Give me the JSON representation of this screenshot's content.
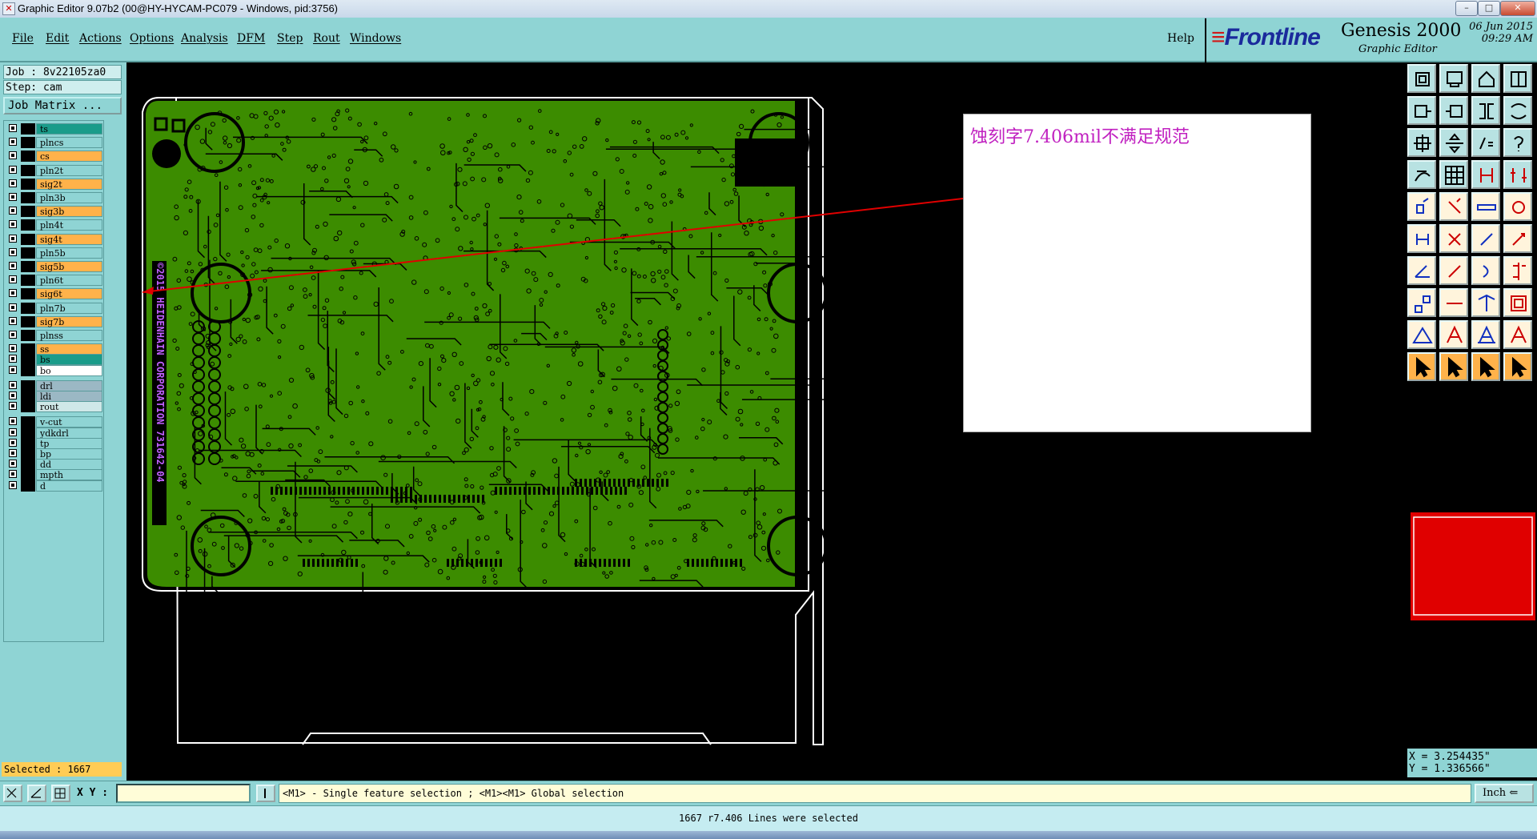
{
  "window": {
    "title": "Graphic Editor 9.07b2 (00@HY-HYCAM-PC079 - Windows, pid:3756)",
    "minimize": "–",
    "maximize": "□",
    "close": "✕"
  },
  "menu": [
    "File",
    "Edit",
    "Actions",
    "Options",
    "Analysis",
    "DFM",
    "Step",
    "Rout",
    "Windows"
  ],
  "help_label": "Help",
  "brand": {
    "logo": "Frontline",
    "product": "Genesis 2000",
    "subtitle": "Graphic Editor",
    "date": "06 Jun 2015",
    "time": "09:29 AM"
  },
  "job": {
    "job_line": "Job : 8v22105za0",
    "step_line": "Step: cam",
    "matrix_button": "Job Matrix ..."
  },
  "layers": [
    {
      "name": "ts",
      "color": "#1a9c8a"
    },
    {
      "name": "plncs",
      "color": "#8fd4d4"
    },
    {
      "name": "cs",
      "color": "#ffb24a"
    },
    {
      "name": "pln2t",
      "color": "#8fd4d4"
    },
    {
      "name": "sig2t",
      "color": "#ffb24a"
    },
    {
      "name": "pln3b",
      "color": "#8fd4d4"
    },
    {
      "name": "sig3b",
      "color": "#ffb24a"
    },
    {
      "name": "pln4t",
      "color": "#8fd4d4"
    },
    {
      "name": "sig4t",
      "color": "#ffb24a"
    },
    {
      "name": "pln5b",
      "color": "#8fd4d4"
    },
    {
      "name": "sig5b",
      "color": "#ffb24a"
    },
    {
      "name": "pln6t",
      "color": "#8fd4d4"
    },
    {
      "name": "sig6t",
      "color": "#ffb24a"
    },
    {
      "name": "pln7b",
      "color": "#8fd4d4"
    },
    {
      "name": "sig7b",
      "color": "#ffb24a"
    },
    {
      "name": "plnss",
      "color": "#8fd4d4"
    },
    {
      "name": "ss",
      "color": "#ffb24a"
    },
    {
      "name": "bs",
      "color": "#1a9c8a"
    },
    {
      "name": "bo",
      "color": "#ffffff"
    },
    {
      "name": "drl",
      "color": "#9bb8c4"
    },
    {
      "name": "ldi",
      "color": "#9bb8c4"
    },
    {
      "name": "rout",
      "color": "#cfe8e8"
    },
    {
      "name": "v-cut",
      "color": "#8fd4d4"
    },
    {
      "name": "ydkdrl",
      "color": "#8fd4d4"
    },
    {
      "name": "tp",
      "color": "#8fd4d4"
    },
    {
      "name": "bp",
      "color": "#8fd4d4"
    },
    {
      "name": "dd",
      "color": "#8fd4d4"
    },
    {
      "name": "mpth",
      "color": "#8fd4d4"
    },
    {
      "name": "d",
      "color": "#8fd4d4"
    }
  ],
  "selected_count": "Selected : 1667",
  "board": {
    "silkscreen_text": "©2015 HEIDENHAIN CORPORATION 731642-04",
    "copper_color": "#3c8c00",
    "silk_color": "#c060ff"
  },
  "annotation": {
    "text": "蚀刻字7.406mil不满足规范",
    "color": "#c020c0"
  },
  "coords": {
    "x": "X = 3.254435\"",
    "y": "Y = 1.336566\""
  },
  "command": {
    "xy_label": "X Y :",
    "hint": "<M1> - Single feature selection ; <M1><M1> Global selection",
    "units": "Inch"
  },
  "status_text": "1667 r7.406 Lines were selected",
  "toolbar_icons": [
    "open-step-icon",
    "save-icon",
    "home-icon",
    "layout-icon",
    "prev-icon",
    "next-icon",
    "split-icon",
    "route-icon",
    "fit-icon",
    "pan-icon",
    "zoom-ratio-icon",
    "query-icon",
    "measure-icon",
    "grid-icon",
    "snap-icon",
    "layers-icon",
    "pad-icon",
    "profile-icon",
    "ruler-icon",
    "dot-icon",
    "net-icon",
    "cross-icon",
    "connect-icon",
    "node-icon",
    "angle-icon",
    "line-icon",
    "arc-icon",
    "mirror-icon",
    "break-icon",
    "minus-icon",
    "resize-icon",
    "copy-icon",
    "triangle-icon",
    "text-a-icon",
    "text-a2-icon",
    "text-a3-icon",
    "pointer-icon",
    "pointer-2-icon",
    "pointer-3-icon",
    "pointer-4-icon"
  ]
}
